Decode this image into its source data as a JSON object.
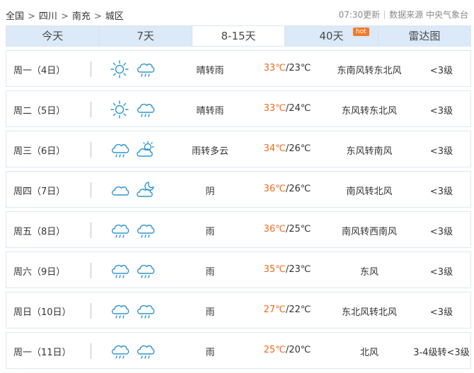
{
  "breadcrumb": {
    "items": [
      "全国",
      "四川",
      "南充",
      "城区"
    ],
    "separator": ">"
  },
  "meta": {
    "update_time": "07:30更新",
    "source": "数据来源 中央气象台"
  },
  "tabs": [
    {
      "label": "今天",
      "active": false
    },
    {
      "label": "7天",
      "active": false
    },
    {
      "label": "8-15天",
      "active": true
    },
    {
      "label": "40天",
      "active": false,
      "badge": "hot"
    },
    {
      "label": "雷达图",
      "active": false
    }
  ],
  "colors": {
    "accent_temp": "#f06b1d",
    "icon_blue": "#2d95d0",
    "tab_bg": "#dbe9f8",
    "row_border": "#dce8f4",
    "hot_badge": "#f27a2b"
  },
  "forecast": [
    {
      "day": "周一（4日）",
      "icon1": "sun-icon",
      "icon2": "rain-icon",
      "desc": "晴转雨",
      "high": "33℃",
      "low": "/23℃",
      "wind": "东南风转东北风",
      "level": "<3级"
    },
    {
      "day": "周二（5日）",
      "icon1": "sun-icon",
      "icon2": "rain-icon",
      "desc": "晴转雨",
      "high": "33℃",
      "low": "/24℃",
      "wind": "东风转东北风",
      "level": "<3级"
    },
    {
      "day": "周三（6日）",
      "icon1": "rain-icon",
      "icon2": "partly-cloudy-icon",
      "desc": "雨转多云",
      "high": "34℃",
      "low": "/26℃",
      "wind": "东风转南风",
      "level": "<3级"
    },
    {
      "day": "周四（7日）",
      "icon1": "cloud-icon",
      "icon2": "partly-cloudy-night-icon",
      "desc": "阴",
      "high": "36℃",
      "low": "/26℃",
      "wind": "南风转北风",
      "level": "<3级"
    },
    {
      "day": "周五（8日）",
      "icon1": "rain-icon",
      "icon2": "rain-icon",
      "desc": "雨",
      "high": "36℃",
      "low": "/25℃",
      "wind": "南风转西南风",
      "level": "<3级"
    },
    {
      "day": "周六（9日）",
      "icon1": "rain-icon",
      "icon2": "rain-icon",
      "desc": "雨",
      "high": "35℃",
      "low": "/23℃",
      "wind": "东风",
      "level": "<3级"
    },
    {
      "day": "周日（10日）",
      "icon1": "rain-icon",
      "icon2": "rain-icon",
      "desc": "雨",
      "high": "27℃",
      "low": "/22℃",
      "wind": "东北风转北风",
      "level": "<3级"
    },
    {
      "day": "周一（11日）",
      "icon1": "rain-icon",
      "icon2": "rain-icon",
      "desc": "雨",
      "high": "25℃",
      "low": "/20℃",
      "wind": "北风",
      "level": "3-4级转<3级"
    }
  ]
}
